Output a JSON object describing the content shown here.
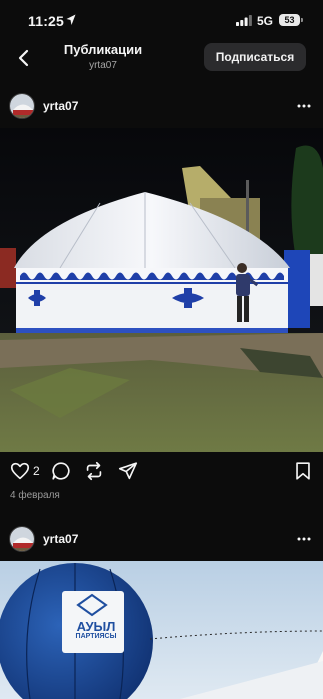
{
  "status_bar": {
    "time": "11:25",
    "network": "5G",
    "battery": "53"
  },
  "header": {
    "title": "Публикации",
    "subtitle": "yrta07",
    "follow_label": "Подписаться"
  },
  "posts": [
    {
      "username": "yrta07",
      "likes": "2",
      "date": "4 февраля",
      "image": "white yurt with blue ornaments lit at night, man standing beside it on grass"
    },
    {
      "username": "yrta07",
      "image": "blue hot-air balloon with white logo on a pale sky",
      "balloon_text": [
        "АУЫЛ",
        "ПАРТИЯСЫ"
      ]
    }
  ],
  "colors": {
    "background": "#0c0c0c",
    "accent_blue": "#1f3fa8",
    "button": "#2b2b2d"
  },
  "icons": [
    "location-arrow-icon",
    "signal-bars-icon",
    "battery-icon",
    "back-chevron-icon",
    "more-dots-icon",
    "heart-icon",
    "comment-icon",
    "repost-icon",
    "send-icon",
    "bookmark-icon"
  ]
}
